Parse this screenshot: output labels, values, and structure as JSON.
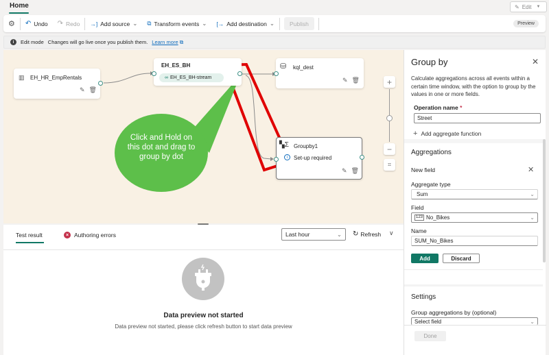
{
  "header": {
    "home_tab": "Home",
    "edit_button": "Edit"
  },
  "toolbar": {
    "undo": "Undo",
    "redo": "Redo",
    "add_source": "Add source",
    "transform_events": "Transform events",
    "add_destination": "Add destination",
    "publish": "Publish",
    "preview_badge": "Preview"
  },
  "infobar": {
    "mode": "Edit mode",
    "message": "Changes will go live once you publish them.",
    "link": "Learn more"
  },
  "canvas": {
    "nodes": {
      "source": {
        "title": "EH_HR_EmpRentals"
      },
      "stream": {
        "title": "EH_ES_BH",
        "chip": "EH_ES_BH-stream"
      },
      "destination": {
        "title": "kql_dest"
      },
      "groupby": {
        "title": "Groupby1",
        "status": "Set-up required"
      }
    },
    "callout": {
      "line1": "Click and Hold on",
      "line2": "this dot and drag to",
      "line3": "group by dot",
      "color": "#5dbf4a",
      "highlight_color": "#e00000"
    }
  },
  "bottom_panel": {
    "tabs": [
      {
        "label": "Test result",
        "active": true
      },
      {
        "label": "Authoring errors",
        "active": false
      }
    ],
    "time_range": "Last hour",
    "refresh": "Refresh",
    "empty_title": "Data preview not started",
    "empty_message": "Data preview not started, please click refresh button to start data preview"
  },
  "side_panel": {
    "title": "Group by",
    "description": "Calculate aggregations across all events within a certain time window, with the option to group by the values in one or more fields.",
    "operation_name_label": "Operation name",
    "operation_name_required": "*",
    "operation_name_value": "Street",
    "add_aggregate": "Add aggregate function",
    "aggregations_heading": "Aggregations",
    "new_field": "New field",
    "aggregate_type_label": "Aggregate type",
    "aggregate_type_value": "Sum",
    "field_label": "Field",
    "field_value": "No_Bikes",
    "name_label": "Name",
    "name_value": "SUM_No_Bikes",
    "add_button": "Add",
    "discard_button": "Discard",
    "settings_heading": "Settings",
    "group_by_label": "Group aggregations by (optional)",
    "group_by_placeholder": "Select field",
    "done_button": "Done"
  },
  "colors": {
    "accent": "#117865",
    "canvas_bg": "#f9f1e4",
    "port": "#3c8f85"
  }
}
